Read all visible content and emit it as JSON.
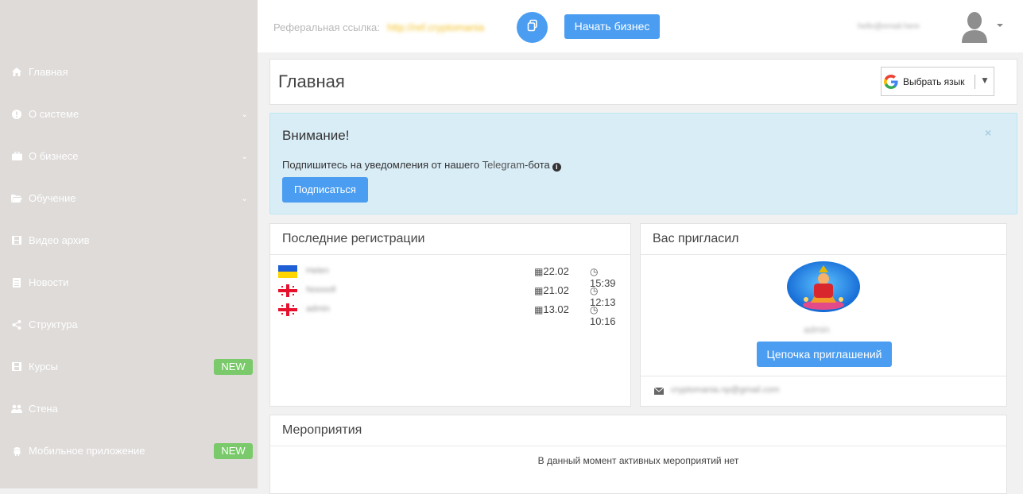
{
  "sidebar": {
    "items": [
      {
        "label": "Главная",
        "icon": "home-icon",
        "chevron": false,
        "badge": ""
      },
      {
        "label": "О системе",
        "icon": "exclamation-circle-icon",
        "chevron": true,
        "badge": ""
      },
      {
        "label": "О бизнесе",
        "icon": "briefcase-icon",
        "chevron": true,
        "badge": ""
      },
      {
        "label": "Обучение",
        "icon": "folder-open-icon",
        "chevron": true,
        "badge": ""
      },
      {
        "label": "Видео архив",
        "icon": "film-icon",
        "chevron": false,
        "badge": ""
      },
      {
        "label": "Новости",
        "icon": "document-icon",
        "chevron": false,
        "badge": ""
      },
      {
        "label": "Структура",
        "icon": "share-icon",
        "chevron": false,
        "badge": ""
      },
      {
        "label": "Курсы",
        "icon": "film-icon",
        "chevron": false,
        "badge": "NEW"
      },
      {
        "label": "Стена",
        "icon": "users-icon",
        "chevron": false,
        "badge": ""
      },
      {
        "label": "Мобильное приложение",
        "icon": "android-icon",
        "chevron": false,
        "badge": "NEW"
      }
    ]
  },
  "topbar": {
    "ref_label": "Реферальная ссылка:",
    "ref_link": "http://ref.cryptomania",
    "start_button": "Начать бизнес",
    "user_email": "hello@email.here"
  },
  "header": {
    "title": "Главная",
    "lang_label": "Выбрать язык"
  },
  "alert": {
    "title": "Внимание!",
    "text_before": "Подпишитесь на уведомления от нашего ",
    "text_link": "Telegram",
    "text_after": "-бота",
    "button": "Подписаться"
  },
  "registrations": {
    "title": "Последние регистрации",
    "rows": [
      {
        "flag": "ukraine",
        "name": "Helen",
        "date": "22.02",
        "time": "15:39"
      },
      {
        "flag": "georgia",
        "name": "Nooooll",
        "date": "21.02",
        "time": "12:13"
      },
      {
        "flag": "georgia",
        "name": "admin",
        "date": "13.02",
        "time": "10:16"
      }
    ]
  },
  "inviter": {
    "title": "Вас пригласил",
    "name": "admin",
    "chain_button": "Цепочка приглашений",
    "email": "cryptomania.np@gmail.com"
  },
  "events": {
    "title": "Мероприятия",
    "empty_text": "В данный момент активных мероприятий нет"
  },
  "colors": {
    "accent": "#4a9df0",
    "badge": "#7ac96a",
    "sidebar_bg": "#dedbd9",
    "alert_bg": "#d9edf7"
  }
}
